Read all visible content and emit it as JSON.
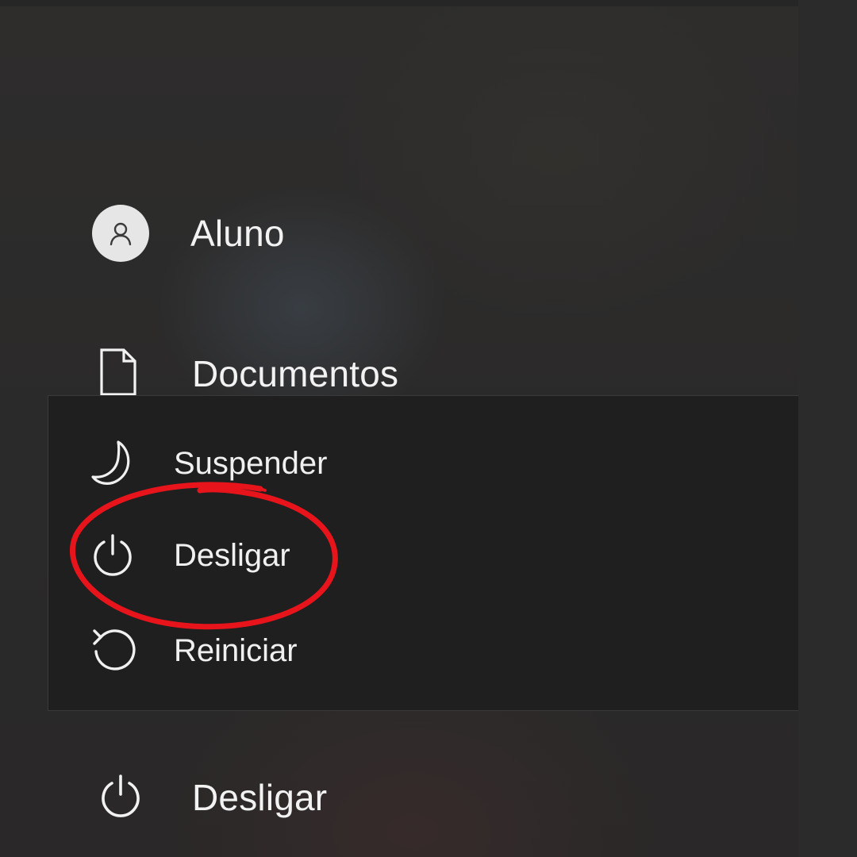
{
  "start_menu": {
    "user": {
      "label": "Aluno",
      "icon": "user-icon"
    },
    "documents": {
      "label": "Documentos",
      "icon": "document-icon"
    },
    "power": {
      "label": "Desligar",
      "icon": "power-icon"
    }
  },
  "power_flyout": {
    "items": [
      {
        "label": "Suspender",
        "icon": "moon-icon"
      },
      {
        "label": "Desligar",
        "icon": "power-icon"
      },
      {
        "label": "Reiniciar",
        "icon": "restart-icon"
      }
    ]
  },
  "annotation": {
    "color": "#e8141b"
  }
}
